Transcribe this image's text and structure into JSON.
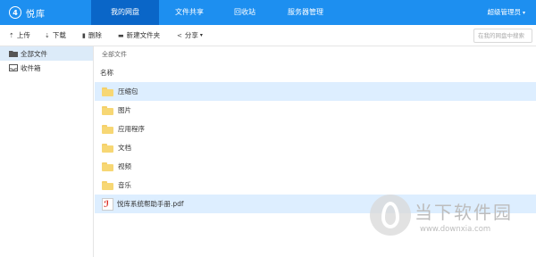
{
  "header": {
    "logo_glyph": "4",
    "logo_text": "悦库",
    "nav": [
      {
        "label": "我的网盘",
        "active": true
      },
      {
        "label": "文件共享",
        "active": false
      },
      {
        "label": "回收站",
        "active": false
      },
      {
        "label": "服务器管理",
        "active": false
      }
    ],
    "user_label": "超级管理员",
    "user_caret": "▾",
    "accent_color": "#1d8ff0"
  },
  "toolbar": {
    "upload_label": "上传",
    "download_label": "下载",
    "delete_label": "删除",
    "new_folder_label": "新建文件夹",
    "share_label": "分享",
    "share_caret": "▾",
    "search_placeholder": "在我的网盘中搜索"
  },
  "sidebar": {
    "items": [
      {
        "label": "全部文件",
        "icon": "folder-icon",
        "active": true
      },
      {
        "label": "收件箱",
        "icon": "inbox-icon",
        "active": false
      }
    ]
  },
  "main": {
    "breadcrumb": "全部文件",
    "column_name": "名称",
    "files": [
      {
        "name": "压缩包",
        "type": "folder",
        "selected": true
      },
      {
        "name": "图片",
        "type": "folder",
        "selected": false
      },
      {
        "name": "应用程序",
        "type": "folder",
        "selected": false
      },
      {
        "name": "文档",
        "type": "folder",
        "selected": false
      },
      {
        "name": "视频",
        "type": "folder",
        "selected": false
      },
      {
        "name": "音乐",
        "type": "folder",
        "selected": false
      },
      {
        "name": "悦库系统帮助手册.pdf",
        "type": "pdf",
        "selected": true
      }
    ]
  },
  "watermark": {
    "title": "当下软件园",
    "url": "www.downxia.com"
  }
}
